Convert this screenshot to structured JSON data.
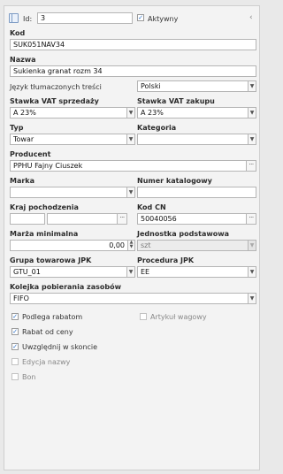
{
  "header": {
    "id_label": "Id:",
    "id_value": "3",
    "active_label": "Aktywny",
    "active_checked": true,
    "collapse_icon": "chevron-left-icon"
  },
  "kod": {
    "label": "Kod",
    "value": "SUK051NAV34"
  },
  "nazwa": {
    "label": "Nazwa",
    "value": "Sukienka granat rozm 34"
  },
  "language": {
    "label": "Język tłumaczonych treści",
    "value": "Polski"
  },
  "vat": {
    "sales_label": "Stawka VAT sprzedaży",
    "sales_value": "A 23%",
    "purchase_label": "Stawka VAT zakupu",
    "purchase_value": "A 23%"
  },
  "typ": {
    "label": "Typ",
    "value": "Towar"
  },
  "kategoria": {
    "label": "Kategoria",
    "value": ""
  },
  "producent": {
    "label": "Producent",
    "value": "PPHU Fajny Ciuszek"
  },
  "marka": {
    "label": "Marka",
    "value": ""
  },
  "numer_katalogowy": {
    "label": "Numer katalogowy",
    "value": ""
  },
  "kraj": {
    "label": "Kraj pochodzenia",
    "value1": "",
    "value2": ""
  },
  "kod_cn": {
    "label": "Kod CN",
    "value": "50040056"
  },
  "marza": {
    "label": "Marża minimalna",
    "value": "0,00"
  },
  "jednostka": {
    "label": "Jednostka podstawowa",
    "value": "szt"
  },
  "grupa_jpk": {
    "label": "Grupa towarowa JPK",
    "value": "GTU_01"
  },
  "procedura_jpk": {
    "label": "Procedura JPK",
    "value": "EE"
  },
  "kolejka": {
    "label": "Kolejka pobierania zasobów",
    "value": "FIFO"
  },
  "checkboxes": {
    "podlega_rabatom": {
      "label": "Podlega rabatom",
      "checked": true
    },
    "artykul_wagowy": {
      "label": "Artykuł wagowy",
      "checked": false
    },
    "rabat_od_ceny": {
      "label": "Rabat od ceny",
      "checked": true
    },
    "uwzglednij": {
      "label": "Uwzględnij w skoncie",
      "checked": true
    },
    "edycja_nazwy": {
      "label": "Edycja nazwy",
      "checked": false
    },
    "bon": {
      "label": "Bon",
      "checked": false
    }
  }
}
